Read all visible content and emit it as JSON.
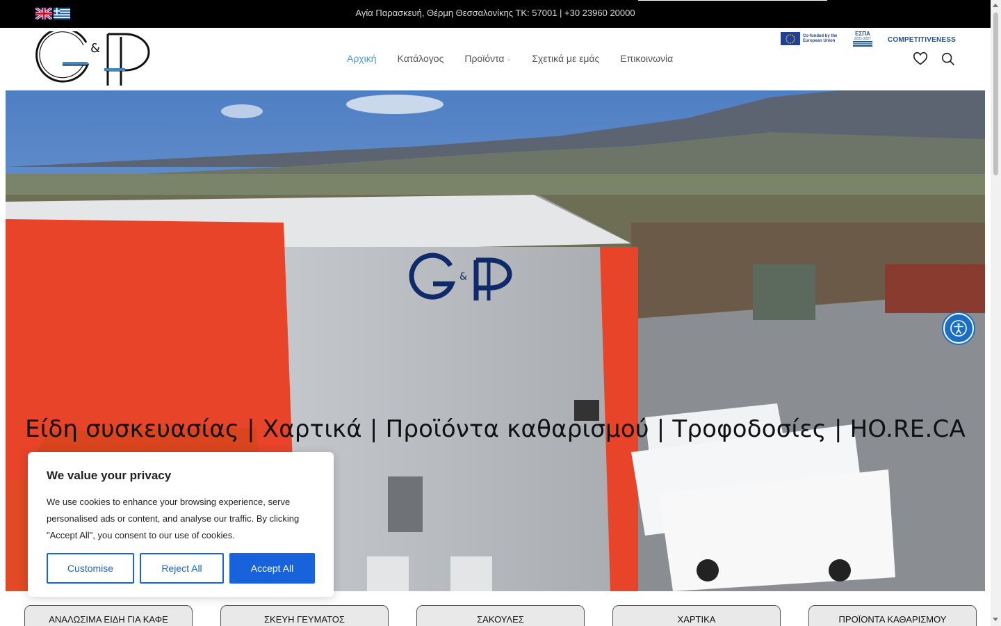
{
  "topbar": {
    "address": "Αγία Παρασκευή, Θέρμη Θεσσαλονίκης ΤΚ: 57001 | +30 23960 20000",
    "languages": [
      "english-flag-icon",
      "greek-flag-icon"
    ]
  },
  "header": {
    "nav": [
      {
        "label": "Αρχική",
        "active": true
      },
      {
        "label": "Κατάλογος",
        "active": false
      },
      {
        "label": "Προϊόντα",
        "active": false,
        "has_dropdown": true
      },
      {
        "label": "Σχετικά με εμάς",
        "active": false
      },
      {
        "label": "Επικοινωνία",
        "active": false
      }
    ],
    "eu_cofunded": "Co-funded by the European Union",
    "espa": "ΕΣΠΑ",
    "espa_years": "2021-2027",
    "competitiveness": "COMPETITIVENESS",
    "icons": [
      "heart-icon",
      "search-icon"
    ]
  },
  "hero": {
    "title": "Είδη συσκευασίας | Χαρτικά | Προϊόντα καθαρισμού | Τροφοδοσίες | HO.RE.CA"
  },
  "categories": [
    "ΑΝΑΛΩΣΙΜΑ ΕΙΔΗ ΓΙΑ ΚΑΦΕ",
    "ΣΚΕΥΗ ΓΕΥΜΑΤΟΣ",
    "ΣΑΚΟΥΛΕΣ",
    "ΧΑΡΤΙΚΑ",
    "ΠΡΟΪΟΝΤΑ ΚΑΘΑΡΙΣΜΟΥ"
  ],
  "cookie": {
    "title": "We value your privacy",
    "text": "We use cookies to enhance your browsing experience, serve personalised ads or content, and analyse our traffic. By clicking \"Accept All\", you consent to our use of cookies.",
    "customise": "Customise",
    "reject": "Reject All",
    "accept": "Accept All"
  },
  "colors": {
    "accent": "#4a9cc9",
    "cookie_blue": "#1863dc",
    "a11y_blue": "#1a6fc4",
    "building_orange": "#e8442a"
  }
}
